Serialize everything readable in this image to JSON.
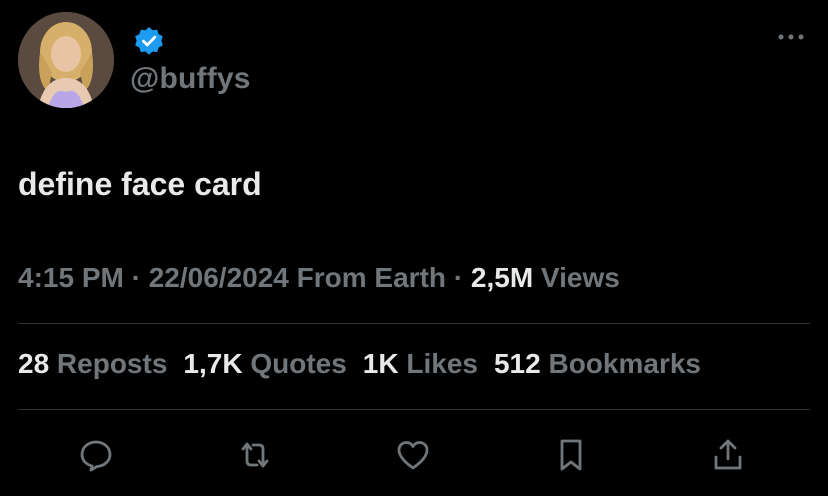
{
  "profile": {
    "handle": "@buffys",
    "verified_color": "#1d9bf0",
    "avatar_icon": "profile-photo"
  },
  "tweet": {
    "text": "define face card"
  },
  "meta": {
    "time": "4:15 PM",
    "sep1": " · ",
    "date": "22/06/2024",
    "source": " From Earth",
    "sep2": " · ",
    "views_count": "2,5M",
    "views_label": " Views"
  },
  "stats": [
    {
      "num": "28",
      "label": " Reposts"
    },
    {
      "num": "1,7K",
      "label": " Quotes"
    },
    {
      "num": "1K",
      "label": " Likes"
    },
    {
      "num": "512",
      "label": " Bookmarks"
    }
  ],
  "actions": {
    "reply_icon": "reply-icon",
    "repost_icon": "repost-icon",
    "like_icon": "like-icon",
    "bookmark_icon": "bookmark-icon",
    "share_icon": "share-icon"
  },
  "colors": {
    "background": "#000000",
    "text_primary": "#e7e9ea",
    "text_secondary": "#71767b",
    "divider": "#2f3336",
    "accent": "#1d9bf0"
  }
}
